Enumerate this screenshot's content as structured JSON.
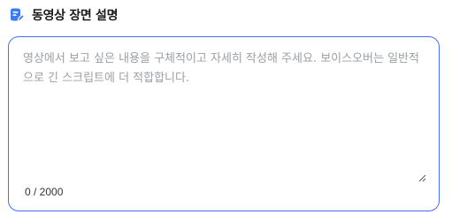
{
  "header": {
    "icon": "edit-document-icon",
    "title": "동영상 장면 설명"
  },
  "description": {
    "value": "",
    "placeholder": "영상에서 보고 싶은 내용을 구체적이고 자세히 작성해 주세요. 보이스오버는 일반적으로 긴 스크립트에 더 적합합니다.",
    "counter": "0 / 2000"
  },
  "colors": {
    "accent": "#4a6cf7",
    "placeholder": "#9aa0a6"
  }
}
